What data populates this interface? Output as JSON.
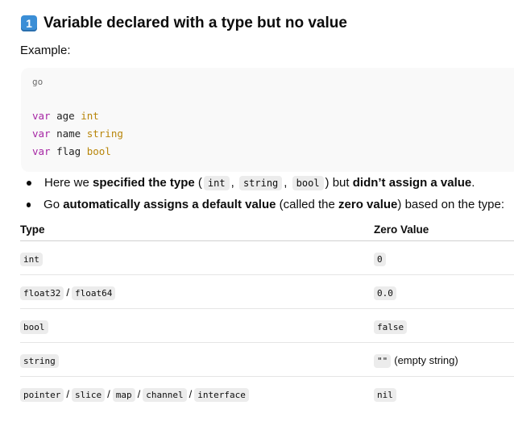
{
  "heading": {
    "number": "1",
    "title": "Variable declared with a type but no value"
  },
  "example_label": "Example:",
  "code": {
    "lang": "go",
    "lines": [
      {
        "kw": "var",
        "name": " age ",
        "type": "int"
      },
      {
        "kw": "var",
        "name": " name ",
        "type": "string"
      },
      {
        "kw": "var",
        "name": " flag ",
        "type": "bool"
      }
    ]
  },
  "bullets": {
    "b1": {
      "t1": "Here we ",
      "bold1": "specified the type",
      "t2": " (",
      "c1": "int",
      "s1": ", ",
      "c2": "string",
      "s2": ", ",
      "c3": "bool",
      "t3": ") but ",
      "bold2": "didn’t assign a value",
      "t4": "."
    },
    "b2": {
      "t1": "Go ",
      "bold1": "automatically assigns a default value",
      "t2": " (called the ",
      "bold2": "zero value",
      "t3": ") based on the type:"
    }
  },
  "table": {
    "headers": [
      "Type",
      "Zero Value"
    ],
    "rows": [
      {
        "types": [
          "int"
        ],
        "value": "0",
        "note": ""
      },
      {
        "types": [
          "float32",
          "float64"
        ],
        "value": "0.0",
        "note": ""
      },
      {
        "types": [
          "bool"
        ],
        "value": "false",
        "note": ""
      },
      {
        "types": [
          "string"
        ],
        "value": "\"\"",
        "note": "(empty string)"
      },
      {
        "types": [
          "pointer",
          "slice",
          "map",
          "channel",
          "interface"
        ],
        "value": "nil",
        "note": ""
      }
    ]
  }
}
